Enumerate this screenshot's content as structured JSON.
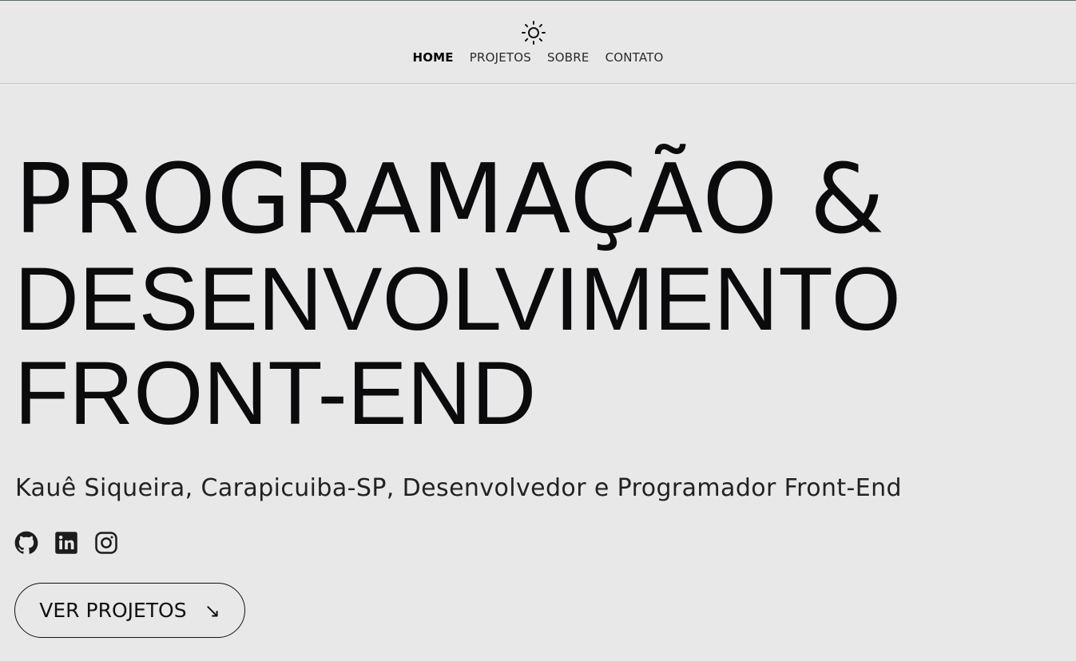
{
  "header": {
    "theme_icon": "sun-icon",
    "nav": [
      {
        "label": "HOME",
        "active": true
      },
      {
        "label": "PROJETOS",
        "active": false
      },
      {
        "label": "SOBRE",
        "active": false
      },
      {
        "label": "CONTATO",
        "active": false
      }
    ]
  },
  "hero": {
    "title_line_1": "PROGRAMAÇÃO &",
    "title_line_2": "DESENVOLVIMENTO",
    "title_line_3": "FRONT-END",
    "subtitle": "Kauê Siqueira, Carapicuiba-SP, Desenvolvedor e Programador Front-End",
    "socials": [
      {
        "icon": "github-icon"
      },
      {
        "icon": "linkedin-icon"
      },
      {
        "icon": "instagram-icon"
      }
    ],
    "cta_label": "VER PROJETOS",
    "cta_arrow": "↘"
  },
  "colors": {
    "background": "#e8e8e8",
    "text": "#0b0b0d",
    "border": "#c9c9c9"
  }
}
